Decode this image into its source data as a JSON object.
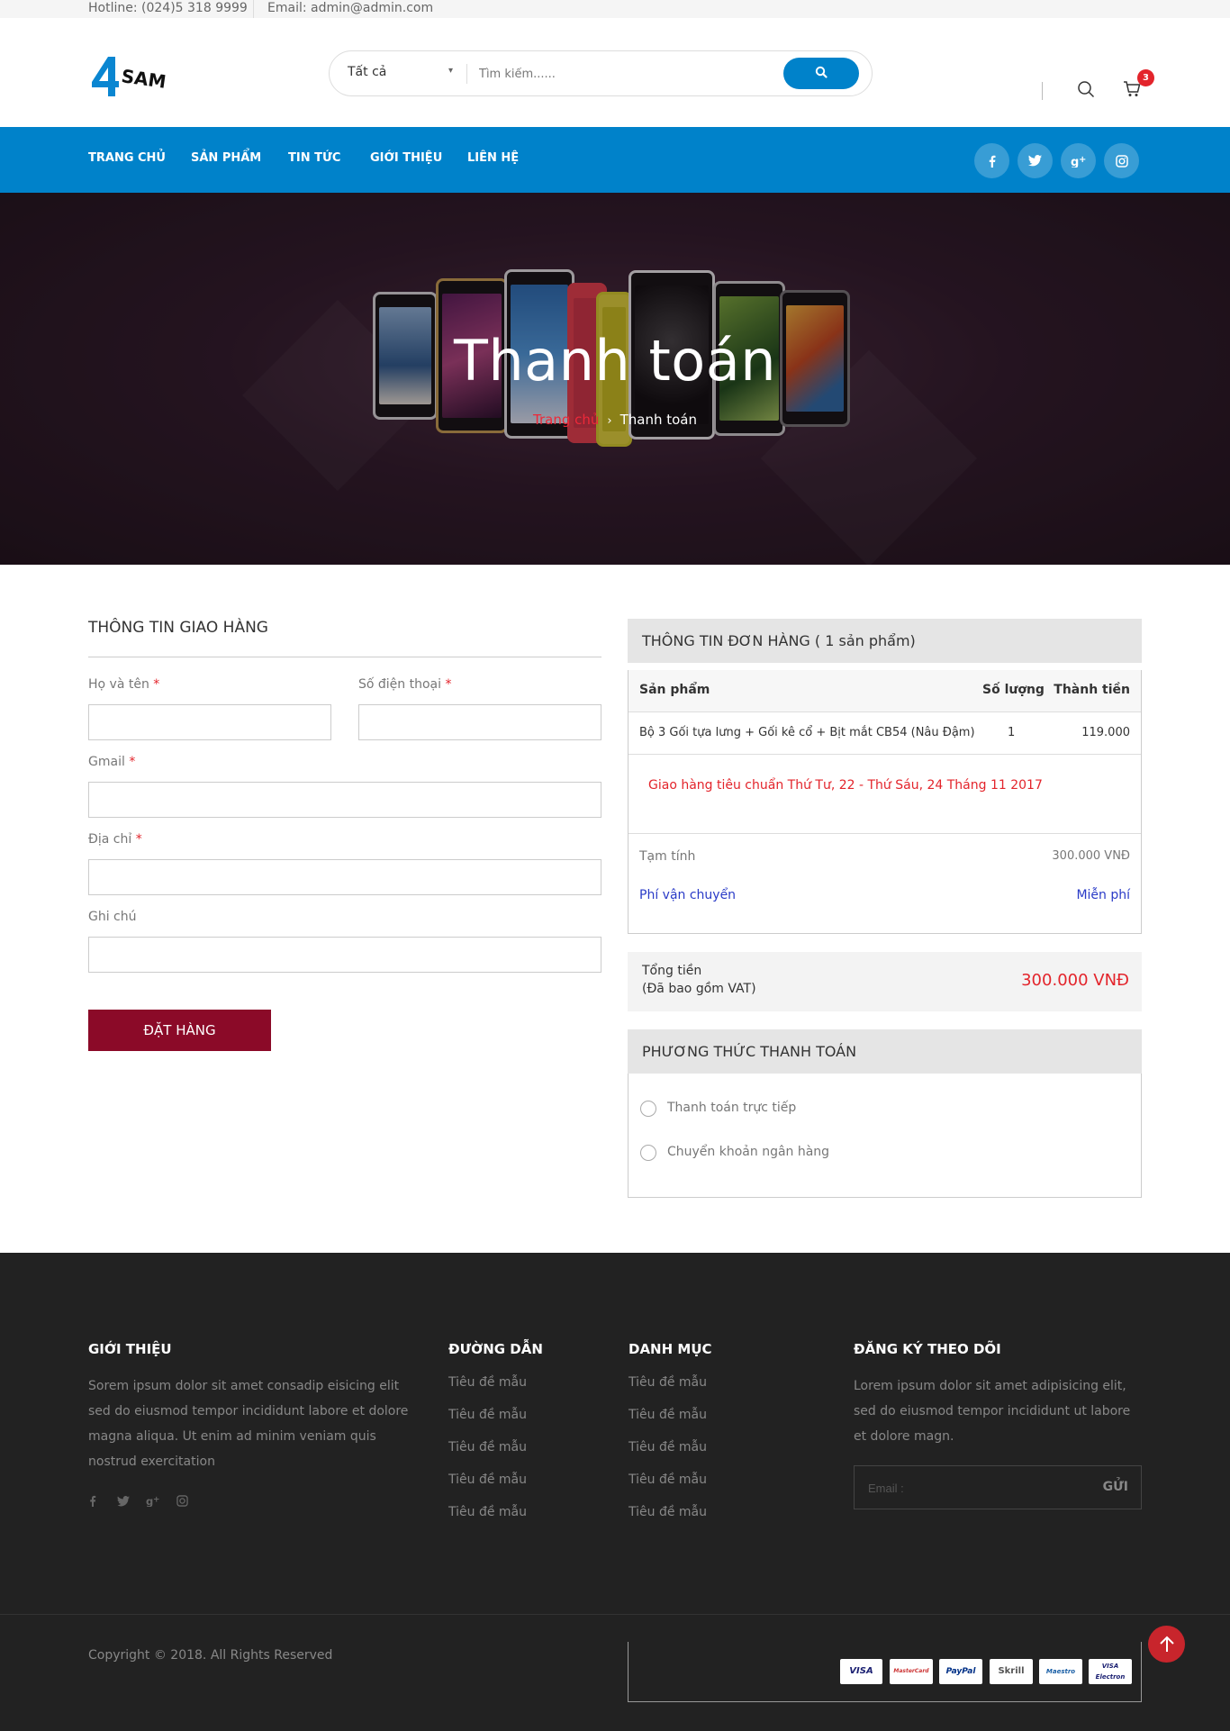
{
  "topbar": {
    "hotline": "Hotline: (024)5 318 9999",
    "email": "Email: admin@admin.com"
  },
  "header": {
    "logo_text": "SAM",
    "logo_number": "4",
    "search": {
      "category": "Tất cả",
      "placeholder": "Tìm kiếm......"
    },
    "cart_count": "3"
  },
  "nav": {
    "items": [
      "TRANG CHỦ",
      "SẢN PHẨM",
      "TIN TỨC",
      "GIỚI THIỆU",
      "LIÊN HỆ"
    ],
    "social": [
      "facebook-icon",
      "twitter-icon",
      "google-plus-icon",
      "instagram-icon"
    ]
  },
  "hero": {
    "title": "Thanh toán",
    "breadcrumb": {
      "home": "Trang chủ",
      "current": "Thanh toán"
    }
  },
  "shipping": {
    "title": "THÔNG TIN GIAO HÀNG",
    "fields": {
      "name": "Họ và tên",
      "phone": "Số điện thoại",
      "gmail": "Gmail",
      "address": "Địa chỉ",
      "note": "Ghi chú"
    },
    "required_mark": "*",
    "submit": "ĐẶT HÀNG"
  },
  "order": {
    "title": "THÔNG TIN ĐƠN HÀNG ( 1 sản phẩm)",
    "columns": [
      "Sản phẩm",
      "Số lượng",
      "Thành tiền"
    ],
    "rows": [
      {
        "product": "Bộ 3 Gối tựa lưng + Gối kê cổ + Bịt mắt CB54 (Nâu Đậm)",
        "qty": "1",
        "price": "119.000"
      }
    ],
    "shipping_note": "Giao hàng tiêu chuẩn Thứ Tư, 22 - Thứ Sáu, 24 Tháng 11 2017",
    "subtotal_label": "Tạm tính",
    "subtotal_value": "300.000 VNĐ",
    "shipping_fee_label": "Phí vận chuyển",
    "shipping_fee_value": "Miễn phí",
    "total_label": "Tổng tiền",
    "total_sub": "(Đã bao gồm VAT)",
    "total_value": "300.000 VNĐ"
  },
  "payment": {
    "title": "PHƯƠNG THỨC THANH TOÁN",
    "options": [
      "Thanh toán trực tiếp",
      "Chuyển khoản ngân hàng"
    ]
  },
  "footer": {
    "about": {
      "title": "GIỚI THIỆU",
      "text": "Sorem ipsum dolor sit amet consadip eisicing elit sed do eiusmod tempor incididunt labore et dolore magna aliqua. Ut enim ad minim veniam quis nostrud exercitation"
    },
    "links": {
      "title": "ĐƯỜNG DẪN",
      "items": [
        "Tiêu đề mẫu",
        "Tiêu đề mẫu",
        "Tiêu đề mẫu",
        "Tiêu đề mẫu",
        "Tiêu đề mẫu"
      ]
    },
    "categories": {
      "title": "DANH MỤC",
      "items": [
        "Tiêu đề mẫu",
        "Tiêu đề mẫu",
        "Tiêu đề mẫu",
        "Tiêu đề mẫu",
        "Tiêu đề mẫu"
      ]
    },
    "subscribe": {
      "title": "ĐĂNG KÝ THEO DÕI",
      "text": "Lorem ipsum dolor sit amet adipisicing elit, sed do eiusmod tempor incididunt ut labore et dolore magn.",
      "placeholder": "Email :",
      "button": "GỬI"
    },
    "copyright": "Copyright © 2018. All Rights Reserved",
    "payment_cards": [
      "VISA",
      "MasterCard",
      "PayPal",
      "Skrill",
      "Maestro",
      "VISA Electron"
    ]
  },
  "colors": {
    "brand_blue": "#0082ca",
    "accent_red": "#e3242b",
    "order_button": "#8b0a28",
    "footer_bg": "#222222"
  }
}
